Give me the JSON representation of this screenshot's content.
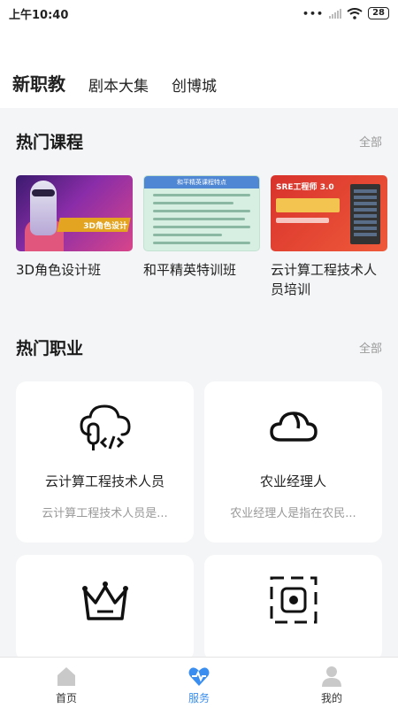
{
  "status": {
    "time": "上午10:40",
    "battery": "28"
  },
  "tabs": [
    {
      "label": "新职教",
      "active": true
    },
    {
      "label": "剧本大集",
      "active": false
    },
    {
      "label": "创博城",
      "active": false
    }
  ],
  "courses_section": {
    "title": "热门课程",
    "all_label": "全部",
    "items": [
      {
        "title": "3D角色设计班",
        "thumb_text": "3D角色设计"
      },
      {
        "title": "和平精英特训班",
        "thumb_text": "和平精英课程特点"
      },
      {
        "title": "云计算工程技术人员培训",
        "thumb_text": "SRE工程师 3.0"
      }
    ]
  },
  "jobs_section": {
    "title": "热门职业",
    "all_label": "全部",
    "items": [
      {
        "title": "云计算工程技术人员",
        "desc": "云计算工程技术人员是...",
        "icon": "cloud-code-icon"
      },
      {
        "title": "农业经理人",
        "desc": "农业经理人是指在农民...",
        "icon": "cloud-icon"
      },
      {
        "title": "",
        "desc": "",
        "icon": "crown-icon"
      },
      {
        "title": "",
        "desc": "",
        "icon": "chip-icon"
      }
    ]
  },
  "bottom_nav": [
    {
      "label": "首页",
      "icon": "home-icon",
      "active": false
    },
    {
      "label": "服务",
      "icon": "service-heart-icon",
      "active": true
    },
    {
      "label": "我的",
      "icon": "user-icon",
      "active": false
    }
  ],
  "colors": {
    "accent": "#3a8ef0",
    "muted": "#999999",
    "background": "#f4f5f7"
  }
}
